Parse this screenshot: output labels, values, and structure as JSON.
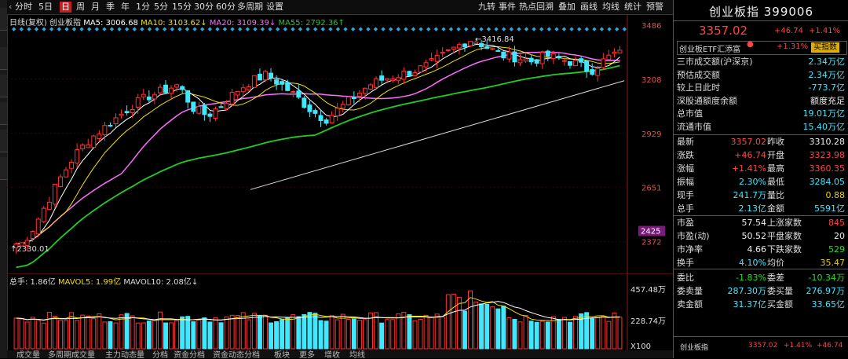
{
  "toolbar": {
    "left": [
      {
        "label": "分时",
        "icon": "chevron-left-icon"
      },
      {
        "label": "5日"
      },
      {
        "label": "日",
        "active": true
      },
      {
        "label": "周"
      },
      {
        "label": "月"
      },
      {
        "label": "季"
      },
      {
        "label": "年"
      },
      {
        "label": "1分"
      },
      {
        "label": "5分"
      },
      {
        "label": "15分"
      },
      {
        "label": "30分"
      },
      {
        "label": "60分"
      },
      {
        "label": "多周期"
      },
      {
        "label": "设置"
      }
    ],
    "right": [
      {
        "label": "九转"
      },
      {
        "label": "事件"
      },
      {
        "label": "热点回溯"
      },
      {
        "label": "叠加"
      },
      {
        "label": "画线"
      },
      {
        "label": "均线"
      },
      {
        "label": "统计"
      },
      {
        "label": "预警"
      }
    ]
  },
  "main_legend": {
    "title": "日线(复权)",
    "name": "创业板指",
    "ma5": "MA5: 3006.68",
    "ma10": "MA10: 3103.62",
    "ma10_arrow": "↓",
    "ma20": "MA20: 3109.39",
    "ma20_arrow": "↓",
    "ma55": "MA55: 2792.36",
    "ma55_arrow": "↑"
  },
  "vol_legend": {
    "vol": "总手: 1.86亿",
    "mavol5": "MAVOL5: 1.99亿",
    "mavol10": "MAVOL10: 2.08亿",
    "arrow": "↓"
  },
  "price_axis": {
    "ticks": [
      {
        "label": "3486",
        "value": 3486
      },
      {
        "label": "3208",
        "value": 3208
      },
      {
        "label": "2929",
        "value": 2929
      },
      {
        "label": "2651",
        "value": 2651
      },
      {
        "label": "2372",
        "value": 2372
      }
    ],
    "current_marker": "2425",
    "high_label": "3416.84",
    "low_label": "2330.01"
  },
  "vol_axis": {
    "ticks": [
      "457.48万",
      "228.74万"
    ],
    "unit": "X100"
  },
  "bottom_tabs": [
    "成交量",
    "多周期成交量",
    "主力动态量",
    "分档",
    "资金分档",
    "资金动态分档",
    "板块",
    "更多",
    "增收",
    "均线"
  ],
  "colors": {
    "up": "#ff3333",
    "down": "#3fe8ff",
    "ma5": "#ffffff",
    "ma10": "#f0e000",
    "ma20": "#ff6dff",
    "ma55": "#22cc22",
    "trend": "#dddddd",
    "bg": "#000000"
  },
  "panel": {
    "title": "创业板指 399006",
    "price": "3357.02",
    "change": "+46.74",
    "percent": "+1.41%",
    "etf_name": "创业板ETF汇添富",
    "etf_dot": "●",
    "etf_pct": "+1.31%",
    "etf_button": "买指数",
    "rows_a": [
      {
        "label": "三市成交额(沪深京)",
        "value": "2.34万亿",
        "color": "cyan"
      },
      {
        "label": "预估成交额",
        "value": "2.34万亿",
        "color": "cyan"
      },
      {
        "label": "较上日此时",
        "value": "-773.7亿",
        "color": "cyan"
      },
      {
        "label": "深股通额度余额",
        "value": "额度充足",
        "color": "white"
      },
      {
        "label": "总市值",
        "value": "19.01万亿",
        "color": "cyan"
      },
      {
        "label": "流通市值",
        "value": "15.40万亿",
        "color": "cyan"
      }
    ],
    "rows_b": [
      {
        "l1": "最新",
        "v1": "3357.02",
        "c1": "red",
        "l2": "昨收",
        "v2": "3310.28",
        "c2": "white"
      },
      {
        "l1": "涨跌",
        "v1": "+46.74",
        "c1": "red",
        "l2": "开盘",
        "v2": "3323.98",
        "c2": "red"
      },
      {
        "l1": "涨幅",
        "v1": "+1.41%",
        "c1": "red",
        "l2": "最高",
        "v2": "3360.35",
        "c2": "red"
      },
      {
        "l1": "振幅",
        "v1": "2.30%",
        "c1": "cyan",
        "l2": "最低",
        "v2": "3284.05",
        "c2": "cyan"
      },
      {
        "l1": "现手",
        "v1": "241.7万",
        "c1": "cyan",
        "l2": "量比",
        "v2": "0.88",
        "c2": "yellow"
      },
      {
        "l1": "总手",
        "v1": "2.13亿",
        "c1": "cyan",
        "l2": "金额",
        "v2": "5591亿",
        "c2": "cyan"
      }
    ],
    "rows_c": [
      {
        "l1": "市盈",
        "v1": "57.54",
        "c1": "white",
        "l2": "上涨家数",
        "v2": "845",
        "c2": "red"
      },
      {
        "l1": "市盈(动)",
        "v1": "50.52",
        "c1": "white",
        "l2": "平盘家数",
        "v2": "20",
        "c2": "white"
      },
      {
        "l1": "市净率",
        "v1": "4.66",
        "c1": "white",
        "l2": "下跌家数",
        "v2": "529",
        "c2": "green"
      },
      {
        "l1": "换手",
        "v1": "4.10%",
        "c1": "cyan",
        "l2": "均价",
        "v2": "35.47",
        "c2": "yellow"
      }
    ],
    "rows_d": [
      {
        "l1": "委比",
        "v1": "-1.83%",
        "c1": "green",
        "l2": "委差",
        "v2": "-10.34万",
        "c2": "green"
      },
      {
        "l1": "委卖量",
        "v1": "287.30万",
        "c1": "cyan",
        "l2": "委买量",
        "v2": "276.97万",
        "c2": "cyan"
      },
      {
        "l1": "卖金额",
        "v1": "31.37亿",
        "c1": "cyan",
        "l2": "买金额",
        "v2": "33.65亿",
        "c2": "cyan"
      }
    ],
    "bottom": {
      "name": "创业板指",
      "price": "3357.02",
      "pct": "+1.41%",
      "chg": "+46.74"
    }
  },
  "chart_data": {
    "type": "candlestick",
    "title": "创业板指 日线(复权)",
    "ylim": [
      2330,
      3486
    ],
    "approx_close_path": [
      2330,
      2420,
      2560,
      2700,
      2820,
      2900,
      2960,
      3020,
      3080,
      3120,
      3150,
      3180,
      3060,
      3020,
      3080,
      3150,
      3200,
      3230,
      3180,
      3120,
      3050,
      3000,
      3060,
      3120,
      3180,
      3210,
      3230,
      3250,
      3280,
      3330,
      3380,
      3416.84,
      3370,
      3330,
      3320,
      3300,
      3330,
      3310,
      3290,
      3250,
      3310,
      3357.02
    ],
    "high": 3416.84,
    "low": 2330.01,
    "series": [
      {
        "name": "MA5",
        "value": 3006.68
      },
      {
        "name": "MA10",
        "value": 3103.62
      },
      {
        "name": "MA20",
        "value": 3109.39
      },
      {
        "name": "MA55",
        "value": 2792.36
      }
    ],
    "volume": {
      "vol": "1.86亿",
      "mavol5": "1.99亿",
      "mavol10": "2.08亿",
      "ylim_label": "457.48万"
    }
  }
}
